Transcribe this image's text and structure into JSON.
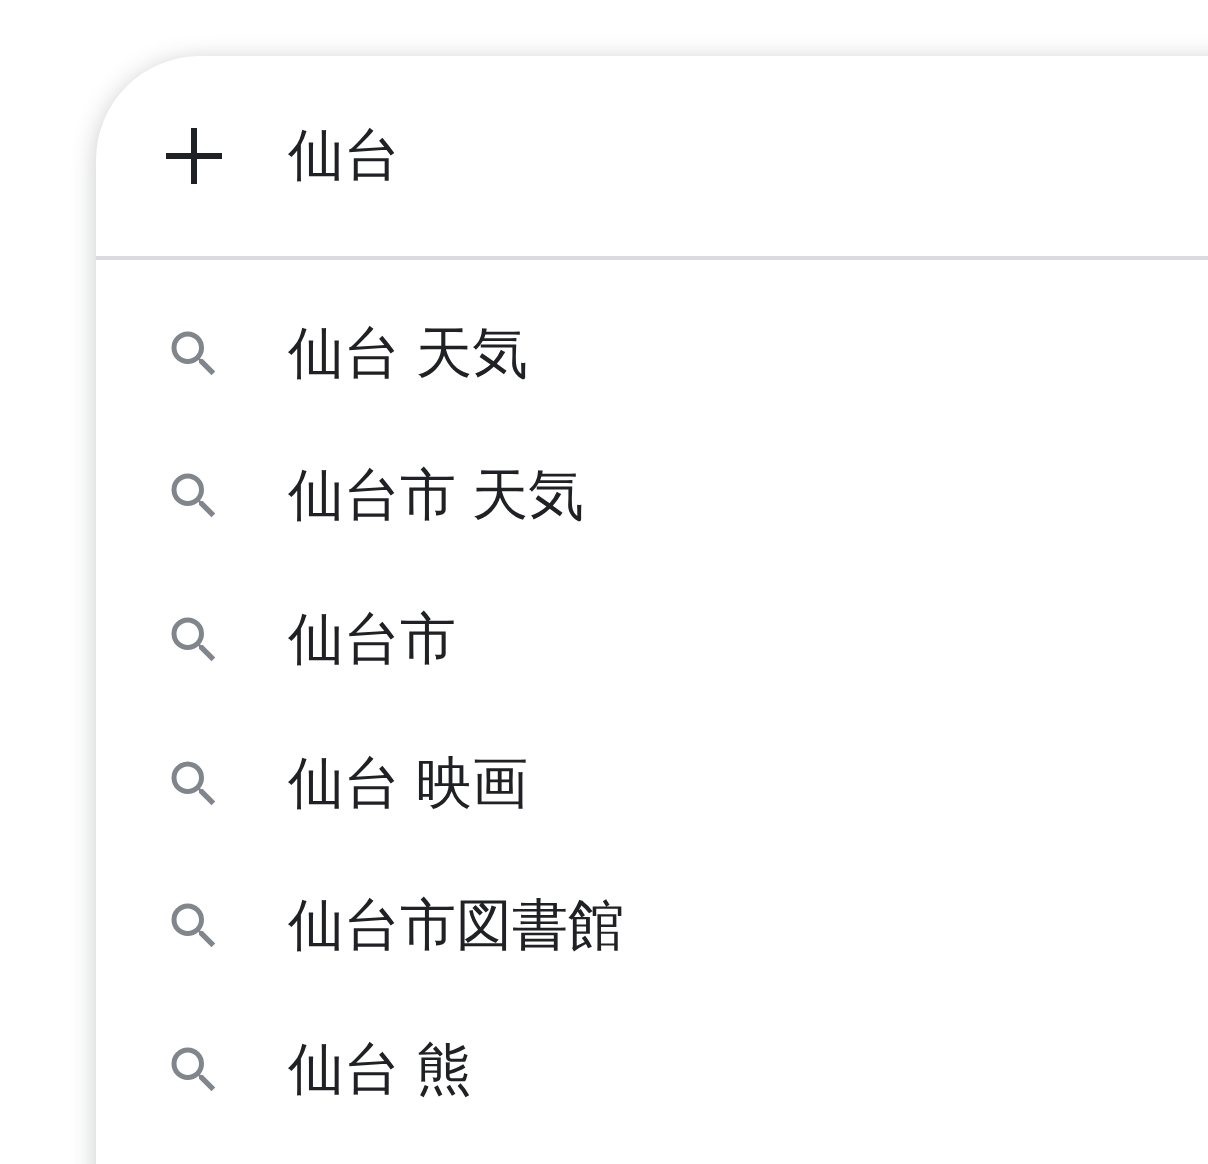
{
  "search": {
    "value": "仙台"
  },
  "suggestions": [
    {
      "text": "仙台 天気"
    },
    {
      "text": "仙台市 天気"
    },
    {
      "text": "仙台市"
    },
    {
      "text": "仙台 映画"
    },
    {
      "text": "仙台市図書館"
    },
    {
      "text": "仙台 熊"
    }
  ]
}
